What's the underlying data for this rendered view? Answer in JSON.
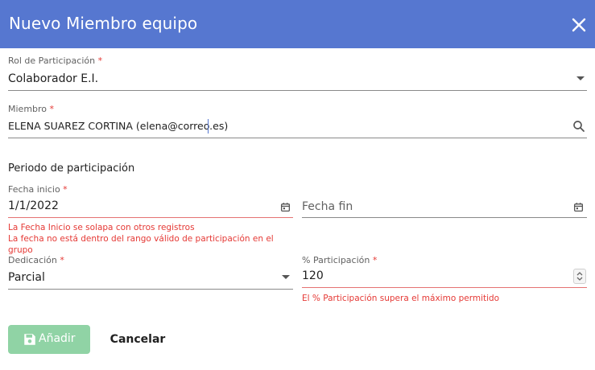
{
  "dialog": {
    "title": "Nuevo Miembro equipo",
    "close_icon": "close-icon"
  },
  "form": {
    "rol": {
      "label": "Rol de Participación",
      "required_mark": "*",
      "value": "Colaborador E.I."
    },
    "miembro": {
      "label": "Miembro",
      "required_mark": "*",
      "value": "ELENA SUAREZ CORTINA (elena@correo.es)"
    },
    "periodo_title": "Periodo de participación",
    "fecha_inicio": {
      "label": "Fecha inicio",
      "required_mark": "*",
      "value": "1/1/2022",
      "errors": [
        "La Fecha Inicio se solapa con otros registros",
        "La fecha no está dentro del rango válido de participación en el grupo"
      ]
    },
    "fecha_fin": {
      "placeholder": "Fecha fin"
    },
    "dedicacion": {
      "label": "Dedicación",
      "required_mark": "*",
      "value": "Parcial"
    },
    "participacion": {
      "label": "% Participación",
      "required_mark": "*",
      "value": "120",
      "error": "El % Participación supera el máximo permitido"
    }
  },
  "actions": {
    "add_label": "Añadir",
    "cancel_label": "Cancelar"
  },
  "colors": {
    "header": "#5677d0",
    "error": "#e53935",
    "add_button_disabled": "#90d3a5"
  }
}
